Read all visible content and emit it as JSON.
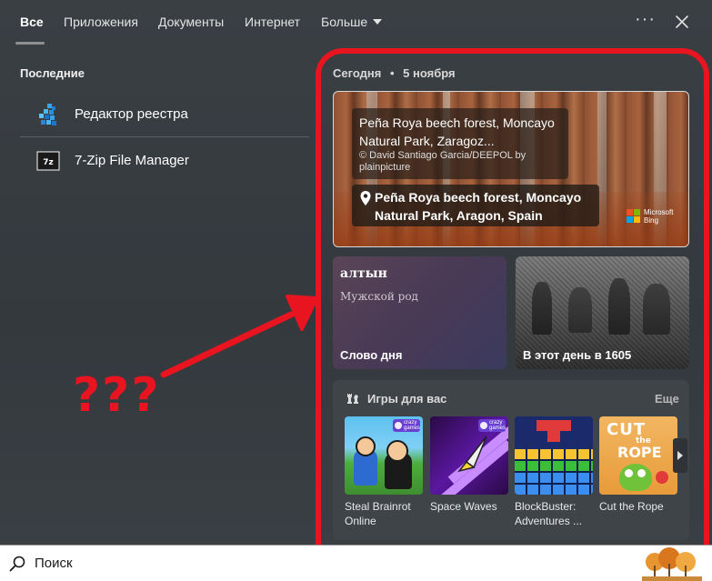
{
  "tabs": [
    {
      "label": "Все",
      "active": true
    },
    {
      "label": "Приложения"
    },
    {
      "label": "Документы"
    },
    {
      "label": "Интернет"
    },
    {
      "label": "Больше"
    }
  ],
  "window": {
    "more_icon": "more-horizontal-icon",
    "close_icon": "close-icon"
  },
  "recent": {
    "title": "Последние",
    "items": [
      {
        "label": "Редактор реестра",
        "icon": "registry-editor-icon"
      },
      {
        "label": "7-Zip File Manager",
        "icon": "7zip-icon"
      }
    ]
  },
  "annotation": {
    "text": "???",
    "color": "#e8141f"
  },
  "today": {
    "label": "Сегодня",
    "separator": "•",
    "date": "5 ноября"
  },
  "hero": {
    "title": "Peña Roya beech forest, Moncayo Natural Park, Zaragoz...",
    "credit": "© David Santiago Garcia/DEEPOL by plainpicture",
    "location": "Peña Roya beech forest, Moncayo Natural Park, Aragon, Spain",
    "brand_line1": "Microsoft",
    "brand_line2": "Bing"
  },
  "word_of_day": {
    "word": "алтын",
    "gender": "Мужской род",
    "label": "Слово дня"
  },
  "on_this_day": {
    "label": "В этот день в 1605"
  },
  "games": {
    "title": "Игры для вас",
    "more": "Еще",
    "badge": "crazy games",
    "items": [
      {
        "name": "Steal Brainrot Online"
      },
      {
        "name": "Space Waves"
      },
      {
        "name": "BlockBuster: Adventures ..."
      },
      {
        "name": "Cut the Rope"
      }
    ]
  },
  "search": {
    "placeholder": "Поиск"
  },
  "colors": {
    "accent_red": "#e8141f",
    "bg": "#383d42",
    "panel": "#3f4449"
  }
}
